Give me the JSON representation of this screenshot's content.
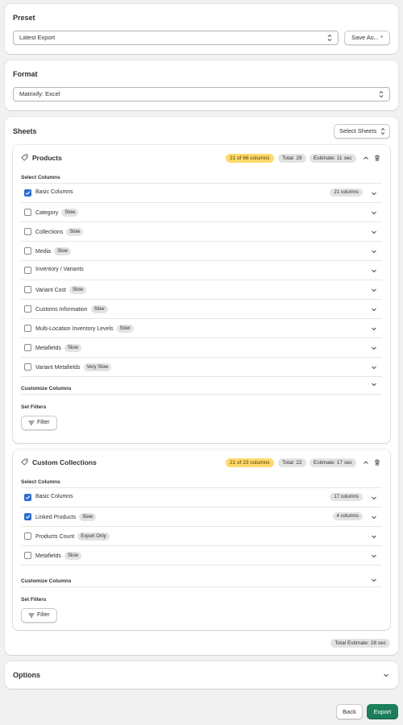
{
  "preset": {
    "title": "Preset",
    "selected": "Latest Export",
    "save_as_label": "Save As... *"
  },
  "format": {
    "title": "Format",
    "selected": "Matrixify: Excel"
  },
  "sheets": {
    "title": "Sheets",
    "select_sheets_label": "Select Sheets",
    "products": {
      "title": "Products",
      "columns_badge": "21 of 66 columns",
      "total_badge": "Total: 29",
      "estimate_badge": "Estimate: 11 sec",
      "select_columns_label": "Select Columns",
      "rows": [
        {
          "label": "Basic Columns",
          "checked": true,
          "badge": "",
          "right_badge": "21 columns"
        },
        {
          "label": "Category",
          "checked": false,
          "badge": "Slow",
          "right_badge": ""
        },
        {
          "label": "Collections",
          "checked": false,
          "badge": "Slow",
          "right_badge": ""
        },
        {
          "label": "Media",
          "checked": false,
          "badge": "Slow",
          "right_badge": ""
        },
        {
          "label": "Inventory / Variants",
          "checked": false,
          "badge": "",
          "right_badge": ""
        },
        {
          "label": "Variant Cost",
          "checked": false,
          "badge": "Slow",
          "right_badge": ""
        },
        {
          "label": "Customs Information",
          "checked": false,
          "badge": "Slow",
          "right_badge": ""
        },
        {
          "label": "Multi-Location Inventory Levels",
          "checked": false,
          "badge": "Slow",
          "right_badge": ""
        },
        {
          "label": "Metafields",
          "checked": false,
          "badge": "Slow",
          "right_badge": ""
        },
        {
          "label": "Variant Metafields",
          "checked": false,
          "badge": "Very Slow",
          "right_badge": ""
        }
      ],
      "customize_columns_label": "Customize Columns",
      "set_filters_label": "Set Filters",
      "filter_label": "Filter"
    },
    "custom_collections": {
      "title": "Custom Collections",
      "columns_badge": "21 of 23 columns",
      "total_badge": "Total: 22",
      "estimate_badge": "Estimate: 17 sec",
      "select_columns_label": "Select Columns",
      "rows": [
        {
          "label": "Basic Columns",
          "checked": true,
          "badge": "",
          "right_badge": "17 columns"
        },
        {
          "label": "Linked Products",
          "checked": true,
          "badge": "Slow",
          "right_badge": "4 columns"
        },
        {
          "label": "Products Count",
          "checked": false,
          "badge": "Export Only",
          "right_badge": ""
        },
        {
          "label": "Metafields",
          "checked": false,
          "badge": "Slow",
          "right_badge": ""
        }
      ],
      "customize_columns_label": "Customize Columns",
      "set_filters_label": "Set Filters",
      "filter_label": "Filter"
    },
    "total_estimate": "Total Estimate: 28 sec"
  },
  "options": {
    "title": "Options"
  },
  "footer": {
    "back_label": "Back",
    "export_label": "Export"
  },
  "colors": {
    "accent_blue": "#2c6ecb",
    "export_green": "#1a7f5a",
    "warning_yellow": "#ffd96b"
  }
}
